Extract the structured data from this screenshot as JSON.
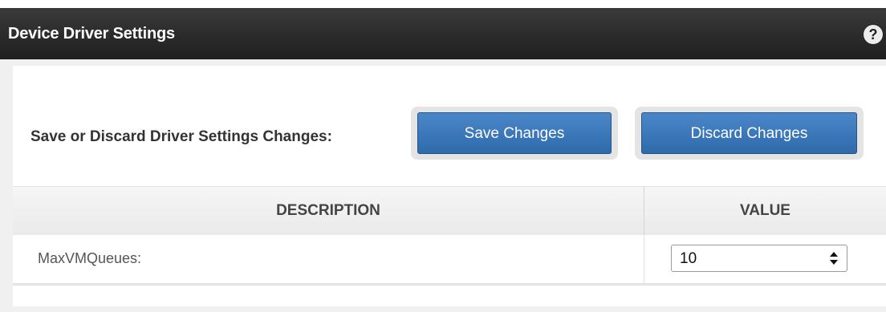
{
  "header": {
    "title": "Device Driver Settings",
    "help_label": "?"
  },
  "actions": {
    "label": "Save or Discard Driver Settings Changes:",
    "save_label": "Save Changes",
    "discard_label": "Discard Changes"
  },
  "table": {
    "columns": [
      "DESCRIPTION",
      "VALUE"
    ],
    "rows": [
      {
        "name": "MaxVMQueues:",
        "value": "10"
      }
    ]
  },
  "colors": {
    "header_bg": "#2a2a2a",
    "button_blue": "#3a78be"
  },
  "icons": {
    "help": "question-mark-icon",
    "select": "up-down-chevron-icon"
  }
}
